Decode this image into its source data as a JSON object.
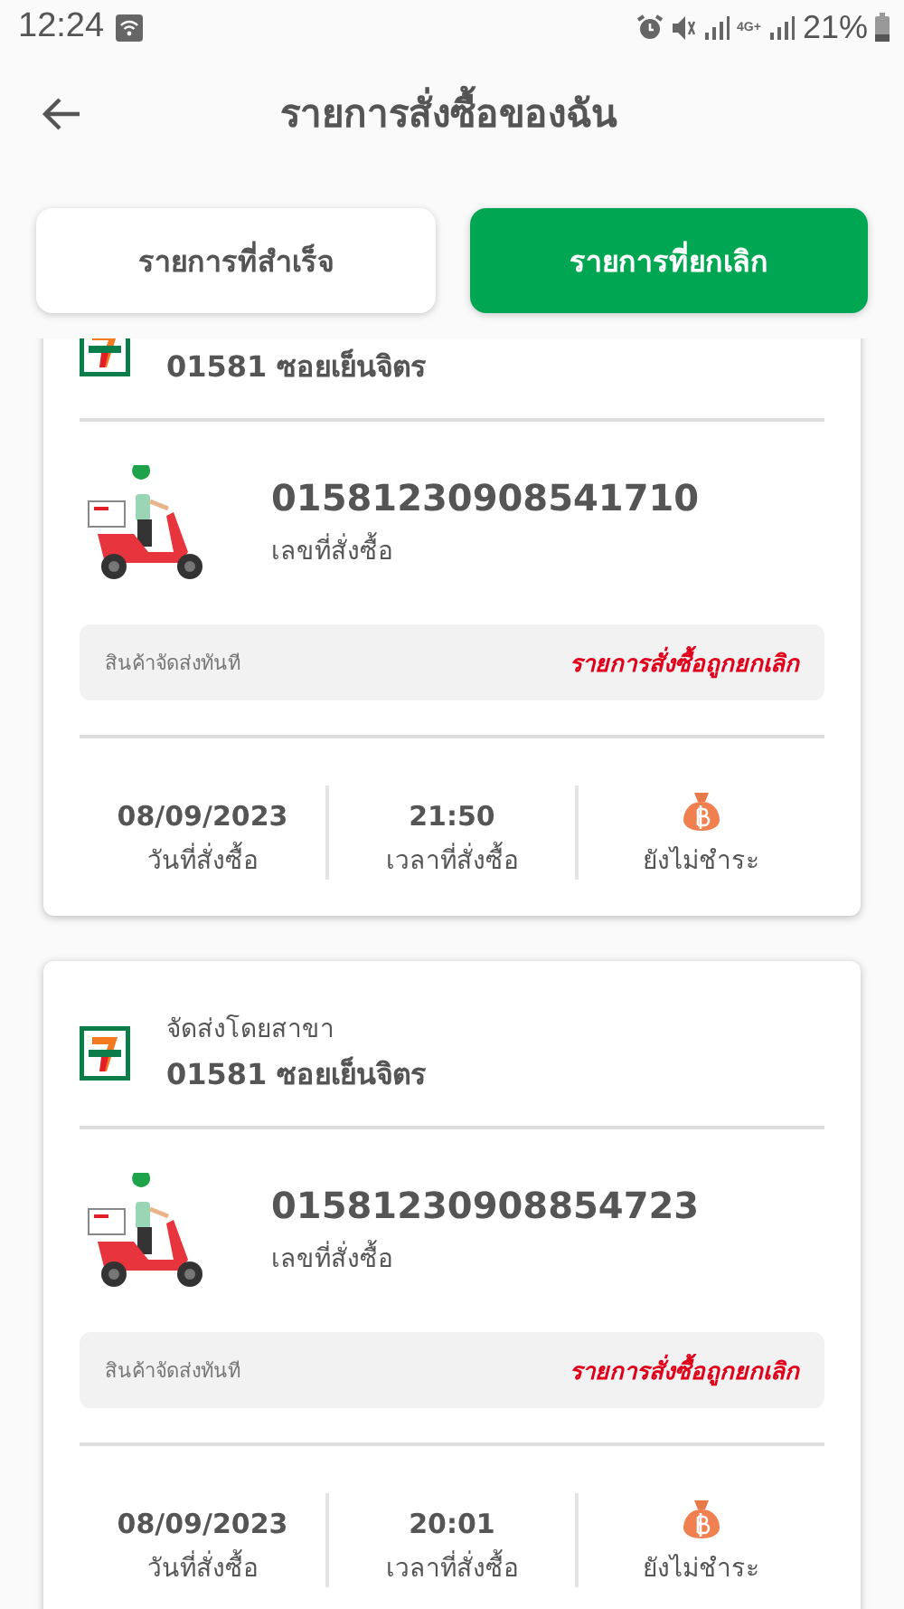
{
  "status_bar": {
    "time": "12:24",
    "network": "4G+",
    "battery": "21%"
  },
  "header": {
    "title": "รายการสั่งซื้อของฉัน"
  },
  "tabs": [
    {
      "label": "รายการที่สำเร็จ",
      "selected": false
    },
    {
      "label": "รายการที่ยกเลิก",
      "selected": true
    }
  ],
  "orders": [
    {
      "store": "01581 ซอยเย็นจิตร",
      "order_number": "01581230908541710",
      "order_number_label": "เลขที่สั่งซื้อ",
      "delivery_type": "สินค้าจัดส่งทันที",
      "status": "รายการสั่งซื้อถูกยกเลิก",
      "date": "08/09/2023",
      "date_label": "วันที่สั่งซื้อ",
      "time": "21:50",
      "time_label": "เวลาที่สั่งซื้อ",
      "payment": "ยังไม่ชำระ"
    },
    {
      "delivery_label": "จัดส่งโดยสาขา",
      "store": "01581 ซอยเย็นจิตร",
      "order_number": "01581230908854723",
      "order_number_label": "เลขที่สั่งซื้อ",
      "delivery_type": "สินค้าจัดส่งทันที",
      "status": "รายการสั่งซื้อถูกยกเลิก",
      "date": "08/09/2023",
      "date_label": "วันที่สั่งซื้อ",
      "time": "20:01",
      "time_label": "เวลาที่สั่งซื้อ",
      "payment": "ยังไม่ชำระ"
    }
  ]
}
